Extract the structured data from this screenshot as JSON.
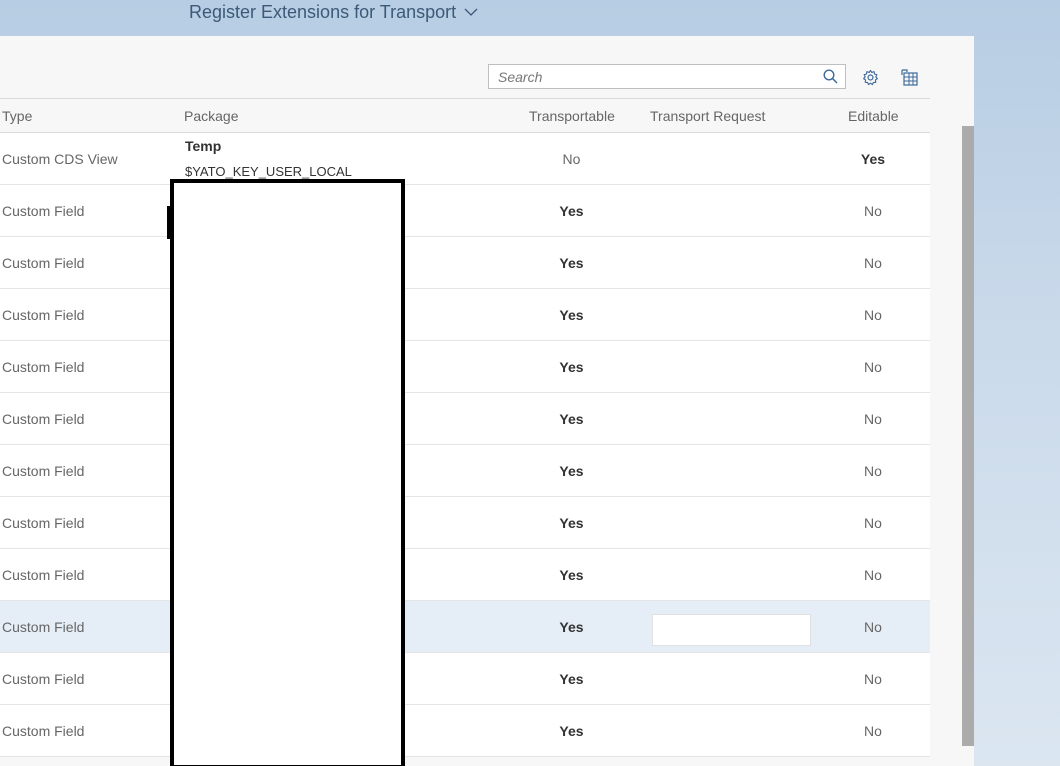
{
  "shell": {
    "title": "Register Extensions for Transport"
  },
  "toolbar": {
    "search_placeholder": "Search",
    "search_icon": "search-icon",
    "settings_icon": "gear-icon",
    "export_icon": "export-icon"
  },
  "table": {
    "columns": [
      "Type",
      "Package",
      "Transportable",
      "Transport Request",
      "Editable"
    ],
    "rows": [
      {
        "type": "Custom CDS View",
        "package_name": "Temp",
        "package_id": "$YATO_KEY_USER_LOCAL",
        "transportable": "No",
        "editable": "Yes"
      },
      {
        "type": "Custom Field",
        "transportable": "Yes",
        "editable": "No"
      },
      {
        "type": "Custom Field",
        "transportable": "Yes",
        "editable": "No"
      },
      {
        "type": "Custom Field",
        "transportable": "Yes",
        "editable": "No"
      },
      {
        "type": "Custom Field",
        "transportable": "Yes",
        "editable": "No"
      },
      {
        "type": "Custom Field",
        "transportable": "Yes",
        "editable": "No"
      },
      {
        "type": "Custom Field",
        "transportable": "Yes",
        "editable": "No"
      },
      {
        "type": "Custom Field",
        "transportable": "Yes",
        "editable": "No"
      },
      {
        "type": "Custom Field",
        "transportable": "Yes",
        "editable": "No"
      },
      {
        "type": "Custom Field",
        "transportable": "Yes",
        "editable": "No"
      },
      {
        "type": "Custom Field",
        "transportable": "Yes",
        "editable": "No"
      },
      {
        "type": "Custom Field",
        "transportable": "Yes",
        "editable": "No"
      }
    ]
  },
  "colors": {
    "title": "#3c5a78",
    "selected_row": "#e5edf6",
    "icon": "#3d6a99"
  }
}
